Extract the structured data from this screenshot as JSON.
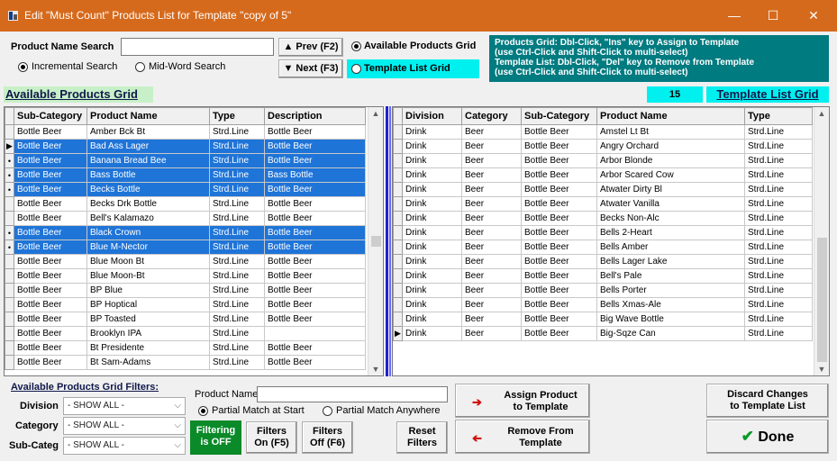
{
  "window": {
    "title": "Edit \"Must Count\" Products List for Template \"copy of 5\"",
    "controls": {
      "minimize": "—",
      "maximize": "☐",
      "close": "✕"
    }
  },
  "search": {
    "label": "Product Name Search",
    "value": "",
    "incremental": "Incremental Search",
    "midword": "Mid-Word Search",
    "selected": "incremental"
  },
  "nav": {
    "prev": "▲ Prev (F2)",
    "next": "▼ Next (F3)"
  },
  "grid_select": {
    "available": "Available Products Grid",
    "template": "Template List Grid",
    "selected": "available"
  },
  "help": {
    "lines": [
      "Products Grid: Dbl-Click, \"Ins\" key to Assign to Template",
      "(use Ctrl-Click and Shift-Click to multi-select)",
      "Template List: Dbl-Click, \"Del\" key to Remove from Template",
      "(use Ctrl-Click and Shift-Click to multi-select)"
    ]
  },
  "available": {
    "header": "Available Products Grid",
    "columns": [
      "Sub-Category",
      "Product Name",
      "Type",
      "Description"
    ],
    "rows": [
      {
        "ind": "",
        "sel": false,
        "cells": [
          "Bottle Beer",
          "Amber Bck Bt",
          "Strd.Line",
          "Bottle Beer"
        ]
      },
      {
        "ind": "▶",
        "sel": true,
        "cells": [
          "Bottle Beer",
          "Bad Ass Lager",
          "Strd.Line",
          "Bottle Beer"
        ]
      },
      {
        "ind": "•",
        "sel": true,
        "cells": [
          "Bottle Beer",
          "Banana Bread Bee",
          "Strd.Line",
          "Bottle Beer"
        ]
      },
      {
        "ind": "•",
        "sel": true,
        "cells": [
          "Bottle Beer",
          "Bass Bottle",
          "Strd.Line",
          "Bass Bottle"
        ]
      },
      {
        "ind": "•",
        "sel": true,
        "cells": [
          "Bottle Beer",
          "Becks Bottle",
          "Strd.Line",
          "Bottle Beer"
        ]
      },
      {
        "ind": "",
        "sel": false,
        "cells": [
          "Bottle Beer",
          "Becks Drk Bottle",
          "Strd.Line",
          "Bottle Beer"
        ]
      },
      {
        "ind": "",
        "sel": false,
        "cells": [
          "Bottle Beer",
          "Bell's Kalamazo",
          "Strd.Line",
          "Bottle Beer"
        ]
      },
      {
        "ind": "•",
        "sel": true,
        "cells": [
          "Bottle Beer",
          "Black Crown",
          "Strd.Line",
          "Bottle Beer"
        ]
      },
      {
        "ind": "•",
        "sel": true,
        "cells": [
          "Bottle Beer",
          "Blue M-Nector",
          "Strd.Line",
          "Bottle Beer"
        ]
      },
      {
        "ind": "",
        "sel": false,
        "cells": [
          "Bottle Beer",
          "Blue Moon Bt",
          "Strd.Line",
          "Bottle Beer"
        ]
      },
      {
        "ind": "",
        "sel": false,
        "cells": [
          "Bottle Beer",
          "Blue Moon-Bt",
          "Strd.Line",
          "Bottle Beer"
        ]
      },
      {
        "ind": "",
        "sel": false,
        "cells": [
          "Bottle Beer",
          "BP Blue",
          "Strd.Line",
          "Bottle Beer"
        ]
      },
      {
        "ind": "",
        "sel": false,
        "cells": [
          "Bottle Beer",
          "BP Hoptical",
          "Strd.Line",
          "Bottle Beer"
        ]
      },
      {
        "ind": "",
        "sel": false,
        "cells": [
          "Bottle Beer",
          "BP Toasted",
          "Strd.Line",
          "Bottle Beer"
        ]
      },
      {
        "ind": "",
        "sel": false,
        "cells": [
          "Bottle Beer",
          "Brooklyn IPA",
          "Strd.Line",
          ""
        ]
      },
      {
        "ind": "",
        "sel": false,
        "cells": [
          "Bottle Beer",
          "Bt Presidente",
          "Strd.Line",
          "Bottle Beer"
        ]
      },
      {
        "ind": "",
        "sel": false,
        "cells": [
          "Bottle Beer",
          "Bt Sam-Adams",
          "Strd.Line",
          "Bottle Beer"
        ]
      }
    ]
  },
  "template": {
    "count": "15",
    "header": "Template List Grid",
    "columns": [
      "Division",
      "Category",
      "Sub-Category",
      "Product Name",
      "Type"
    ],
    "rows": [
      {
        "ind": "",
        "cells": [
          "Drink",
          "Beer",
          "Bottle Beer",
          "Amstel Lt Bt",
          "Strd.Line"
        ]
      },
      {
        "ind": "",
        "cells": [
          "Drink",
          "Beer",
          "Bottle Beer",
          "Angry Orchard",
          "Strd.Line"
        ]
      },
      {
        "ind": "",
        "cells": [
          "Drink",
          "Beer",
          "Bottle Beer",
          "Arbor Blonde",
          "Strd.Line"
        ]
      },
      {
        "ind": "",
        "cells": [
          "Drink",
          "Beer",
          "Bottle Beer",
          "Arbor Scared Cow",
          "Strd.Line"
        ]
      },
      {
        "ind": "",
        "cells": [
          "Drink",
          "Beer",
          "Bottle Beer",
          "Atwater Dirty Bl",
          "Strd.Line"
        ]
      },
      {
        "ind": "",
        "cells": [
          "Drink",
          "Beer",
          "Bottle Beer",
          "Atwater Vanilla",
          "Strd.Line"
        ]
      },
      {
        "ind": "",
        "cells": [
          "Drink",
          "Beer",
          "Bottle Beer",
          "Becks Non-Alc",
          "Strd.Line"
        ]
      },
      {
        "ind": "",
        "cells": [
          "Drink",
          "Beer",
          "Bottle Beer",
          "Bells 2-Heart",
          "Strd.Line"
        ]
      },
      {
        "ind": "",
        "cells": [
          "Drink",
          "Beer",
          "Bottle Beer",
          "Bells Amber",
          "Strd.Line"
        ]
      },
      {
        "ind": "",
        "cells": [
          "Drink",
          "Beer",
          "Bottle Beer",
          "Bells Lager Lake",
          "Strd.Line"
        ]
      },
      {
        "ind": "",
        "cells": [
          "Drink",
          "Beer",
          "Bottle Beer",
          "Bell's Pale",
          "Strd.Line"
        ]
      },
      {
        "ind": "",
        "cells": [
          "Drink",
          "Beer",
          "Bottle Beer",
          "Bells Porter",
          "Strd.Line"
        ]
      },
      {
        "ind": "",
        "cells": [
          "Drink",
          "Beer",
          "Bottle Beer",
          "Bells Xmas-Ale",
          "Strd.Line"
        ]
      },
      {
        "ind": "",
        "cells": [
          "Drink",
          "Beer",
          "Bottle Beer",
          "Big Wave Bottle",
          "Strd.Line"
        ]
      },
      {
        "ind": "▶",
        "cells": [
          "Drink",
          "Beer",
          "Bottle Beer",
          "Big-Sqze Can",
          "Strd.Line"
        ]
      }
    ]
  },
  "filters": {
    "title": "Available Products Grid Filters:",
    "division_label": "Division",
    "division_value": "- SHOW ALL -",
    "category_label": "Category",
    "category_value": "- SHOW ALL -",
    "subcateg_label": "Sub-Categ",
    "subcateg_value": "- SHOW ALL -",
    "product_name_label": "Product Name:",
    "product_name_value": "",
    "partial_start": "Partial Match at Start",
    "partial_anywhere": "Partial Match Anywhere",
    "partial_selected": "start",
    "status_line1": "Filtering",
    "status_line2": "is OFF",
    "filters_on_1": "Filters",
    "filters_on_2": "On (F5)",
    "filters_off_1": "Filters",
    "filters_off_2": "Off (F6)",
    "reset_1": "Reset",
    "reset_2": "Filters"
  },
  "actions": {
    "assign_1": "Assign Product",
    "assign_2": "to Template",
    "remove_1": "Remove From",
    "remove_2": "Template",
    "discard_1": "Discard Changes",
    "discard_2": "to Template List",
    "done": "Done",
    "done_icon": "✔"
  },
  "colors": {
    "title_bar": "#d66a1c",
    "selection": "#1f74d8",
    "teal": "#007b80",
    "cyan": "#00f0f0",
    "green_header": "#c8f0c8",
    "filter_status": "#0a8a28",
    "divider": "#2020d0"
  }
}
